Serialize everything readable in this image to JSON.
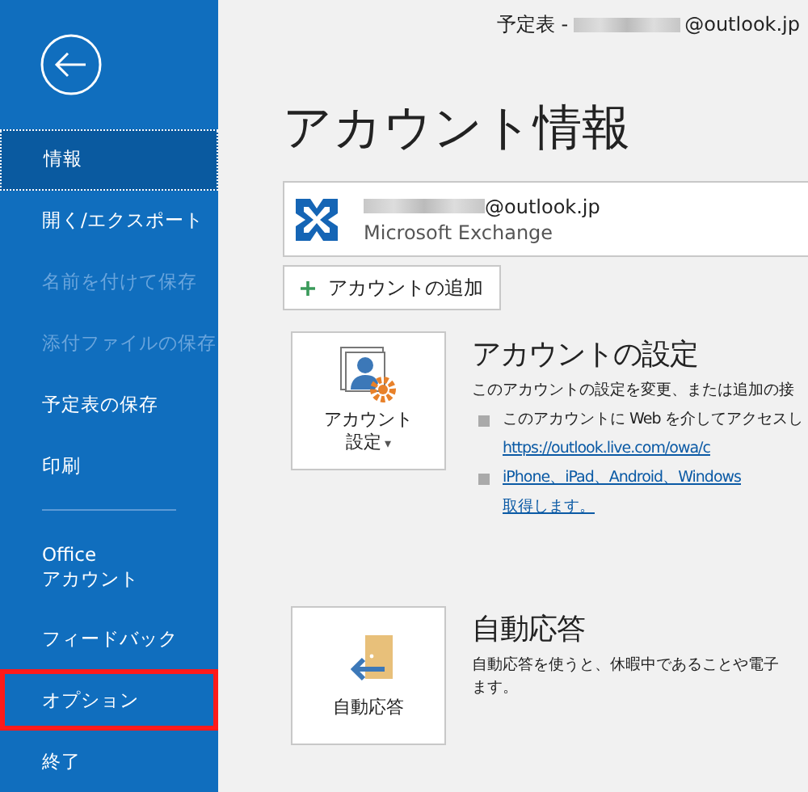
{
  "window": {
    "title_prefix": "予定表 -",
    "title_suffix": "@outlook.jp"
  },
  "sidebar": {
    "items": [
      {
        "label": "情報",
        "selected": true,
        "disabled": false,
        "highlighted": false,
        "divider_before": false
      },
      {
        "label": "開く/エクスポート",
        "selected": false,
        "disabled": false,
        "highlighted": false,
        "divider_before": false
      },
      {
        "label": "名前を付けて保存",
        "selected": false,
        "disabled": true,
        "highlighted": false,
        "divider_before": false
      },
      {
        "label": "添付ファイルの保存",
        "selected": false,
        "disabled": true,
        "highlighted": false,
        "divider_before": false
      },
      {
        "label": "予定表の保存",
        "selected": false,
        "disabled": false,
        "highlighted": false,
        "divider_before": false
      },
      {
        "label": "印刷",
        "selected": false,
        "disabled": false,
        "highlighted": false,
        "divider_before": false
      },
      {
        "label": "Office\nアカウント",
        "selected": false,
        "disabled": false,
        "highlighted": false,
        "divider_before": true
      },
      {
        "label": "フィードバック",
        "selected": false,
        "disabled": false,
        "highlighted": false,
        "divider_before": false
      },
      {
        "label": "オプション",
        "selected": false,
        "disabled": false,
        "highlighted": true,
        "divider_before": false
      },
      {
        "label": "終了",
        "selected": false,
        "disabled": false,
        "highlighted": false,
        "divider_before": false
      }
    ]
  },
  "page_title": "アカウント情報",
  "account": {
    "email_suffix": "@outlook.jp",
    "type": "Microsoft Exchange"
  },
  "add_account_button": "アカウントの追加",
  "sections": [
    {
      "kind": "settings",
      "button": [
        "アカウント",
        "設定"
      ],
      "caret": "▾",
      "heading": "アカウントの設定",
      "description": "このアカウントの設定を変更、または追加の接",
      "bullets": [
        {
          "text": "このアカウントに Web を介してアクセスし",
          "link": "https://outlook.live.com/owa/c"
        },
        {
          "link": "iPhone、iPad、Android、Windows",
          "link2": "取得します。"
        }
      ]
    },
    {
      "kind": "autoreply",
      "button": [
        "自動応答"
      ],
      "heading": "自動応答",
      "description": "自動応答を使うと、休暇中であることや電子ます。"
    }
  ]
}
